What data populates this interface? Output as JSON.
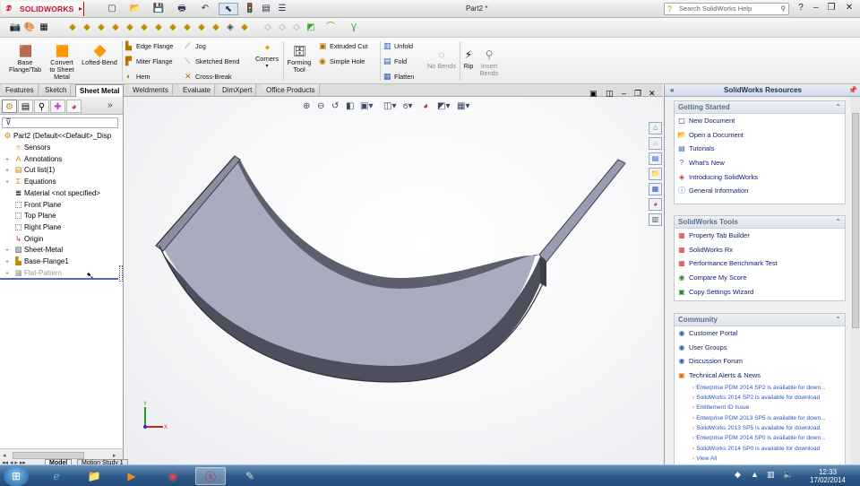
{
  "app": {
    "brand": "SOLIDWORKS",
    "document_title": "Part2 *",
    "search_placeholder": "Search SolidWorks Help"
  },
  "ribbon": {
    "buttons": [
      {
        "label": "Base\nFlange/Tab",
        "icon": "base-flange-icon"
      },
      {
        "label": "Convert\nto Sheet\nMetal",
        "icon": "convert-icon"
      },
      {
        "label": "Lofted-Bend",
        "icon": "lofted-bend-icon"
      },
      {
        "label": "Corners",
        "icon": "corners-icon"
      },
      {
        "label": "Forming\nTool",
        "icon": "forming-tool-icon"
      },
      {
        "label": "No Bends",
        "icon": "no-bends-icon"
      },
      {
        "label": "Rip",
        "icon": "rip-icon"
      },
      {
        "label": "Insert\nBends",
        "icon": "insert-bends-icon"
      }
    ],
    "small": {
      "edge_flange": "Edge Flange",
      "miter_flange": "Miter Flange",
      "hem": "Hem",
      "jog": "Jog",
      "sketched_bend": "Sketched Bend",
      "cross_break": "Cross-Break",
      "extruded_cut": "Extruded Cut",
      "simple_hole": "Simple Hole",
      "unfold": "Unfold",
      "fold": "Fold",
      "flatten": "Flatten"
    }
  },
  "tabs": [
    "Features",
    "Sketch",
    "Sheet Metal",
    "Weldments",
    "Evaluate",
    "DimXpert",
    "Office Products"
  ],
  "active_tab": "Sheet Metal",
  "tree": {
    "root": "Part2  (Default<<Default>_Disp",
    "items": [
      {
        "label": "Sensors",
        "expand": ""
      },
      {
        "label": "Annotations",
        "expand": "+"
      },
      {
        "label": "Cut list(1)",
        "expand": "+"
      },
      {
        "label": "Equations",
        "expand": "+"
      },
      {
        "label": "Material <not specified>",
        "expand": ""
      },
      {
        "label": "Front Plane",
        "expand": ""
      },
      {
        "label": "Top Plane",
        "expand": ""
      },
      {
        "label": "Right Plane",
        "expand": ""
      },
      {
        "label": "Origin",
        "expand": ""
      },
      {
        "label": "Sheet-Metal",
        "expand": "+"
      },
      {
        "label": "Base-Flange1",
        "expand": "+"
      },
      {
        "label": "Flat-Pattern",
        "expand": "+"
      }
    ]
  },
  "bottom_tabs": [
    "Model",
    "Motion Study 1"
  ],
  "resources": {
    "title": "SolidWorks Resources",
    "getting_started": {
      "title": "Getting Started",
      "items": [
        "New Document",
        "Open a Document",
        "Tutorials",
        "What's New",
        "Introducing SolidWorks",
        "General Information"
      ]
    },
    "tools": {
      "title": "SolidWorks Tools",
      "items": [
        "Property Tab Builder",
        "SolidWorks Rx",
        "Performance Benchmark Test",
        "Compare My Score",
        "Copy Settings Wizard"
      ]
    },
    "community": {
      "title": "Community",
      "items": [
        "Customer Portal",
        "User Groups",
        "Discussion Forum",
        "Technical Alerts & News"
      ],
      "news": [
        "Enterprise PDM 2014 SP2 is available for down...",
        "SolidWorks 2014 SP2 is available for download",
        "Entitlement ID Issue",
        "Enterprise PDM 2013 SP5 is available for down...",
        "SolidWorks 2013 SP5 is available for download",
        "Enterprise PDM 2014 SP0 is available for down...",
        "SolidWorks 2014 SP0 is available for download"
      ],
      "view_all": "View All"
    }
  },
  "taskbar": {
    "time": "12:33",
    "date": "17/02/2014"
  },
  "colors": {
    "brand_red": "#c8102e",
    "part_face": "#a9abbe",
    "part_edge": "#4d4f5c",
    "taskbar": "#2f5c8c"
  }
}
